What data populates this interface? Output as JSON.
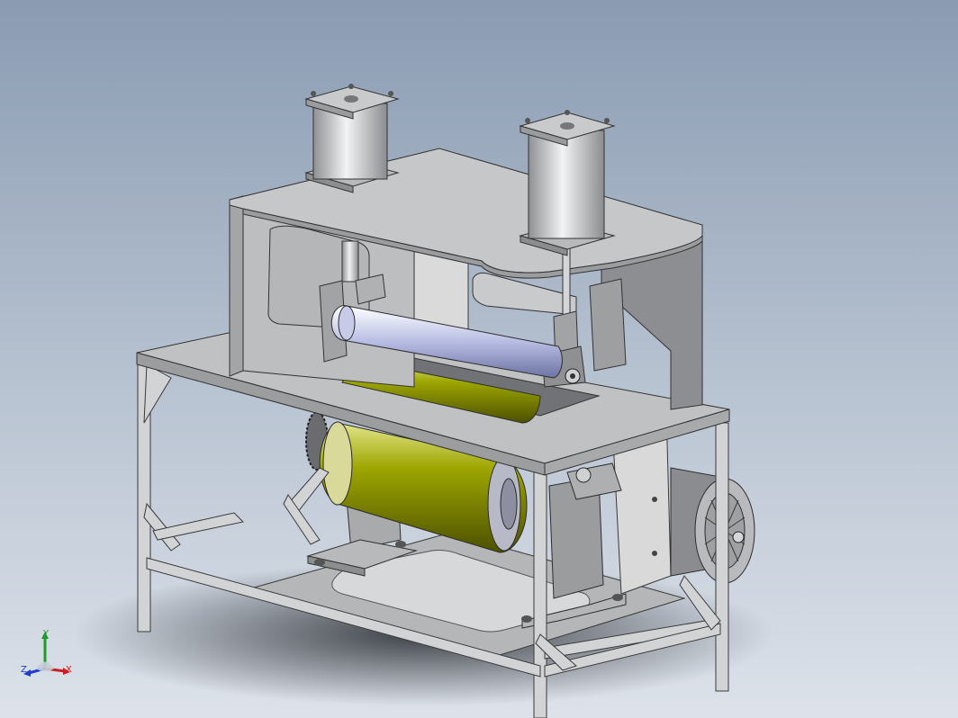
{
  "viewport": {
    "background_top": "#8a9bb2",
    "background_bottom": "#dde2ea"
  },
  "model": {
    "frame_color": "#c7c9cc",
    "plate_color": "#b5b6b8",
    "roller_color": "#8f9400",
    "roller_shaft_color": "#b7bde3",
    "cylinder_color": "#d3d4d6"
  },
  "triad": {
    "x_label": "X",
    "y_label": "Y",
    "z_label": "Z",
    "x_color": "#cc1f1f",
    "y_color": "#1e9a2a",
    "z_color": "#1f3ad0"
  }
}
